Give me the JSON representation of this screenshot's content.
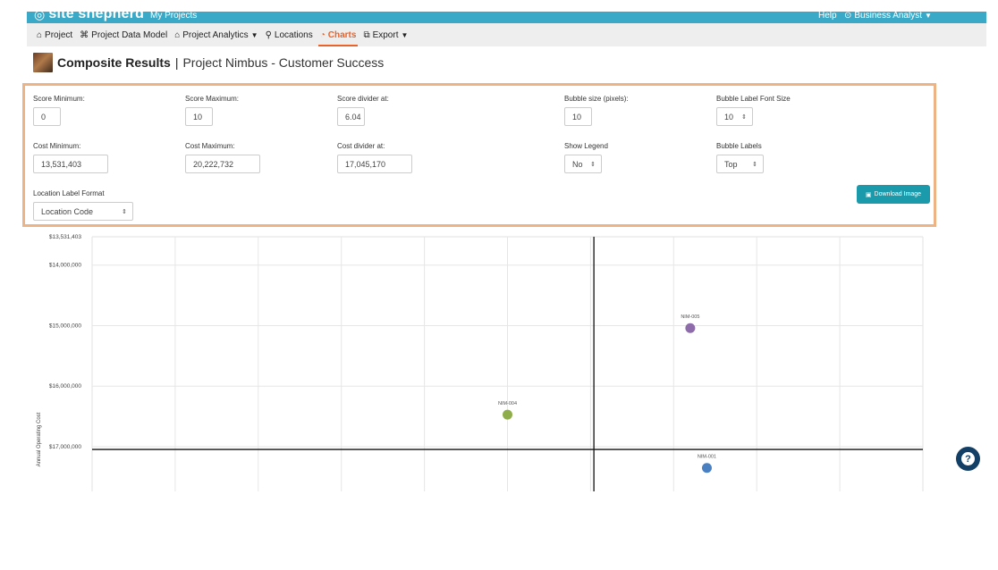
{
  "header": {
    "brand": "site shepherd",
    "my_projects": "My Projects",
    "help": "Help",
    "user": "Business Analyst",
    "color": "#3aa9c7"
  },
  "nav": {
    "items": [
      {
        "label": "Project",
        "icon": "building-icon"
      },
      {
        "label": "Project Data Model",
        "icon": "data-model-icon"
      },
      {
        "label": "Project Analytics",
        "icon": "analytics-icon",
        "dropdown": true
      },
      {
        "label": "Locations",
        "icon": "map-pin-icon"
      },
      {
        "label": "Charts",
        "icon": "chart-icon",
        "active": true
      },
      {
        "label": "Export",
        "icon": "export-icon",
        "dropdown": true
      }
    ],
    "active_color": "#e8622a"
  },
  "page": {
    "title": "Composite Results",
    "separator": "|",
    "subtitle": "Project Nimbus - Customer Success"
  },
  "controls": {
    "score_min": {
      "label": "Score Minimum:",
      "value": "0"
    },
    "score_max": {
      "label": "Score Maximum:",
      "value": "10"
    },
    "score_divider": {
      "label": "Score divider at:",
      "value": "6.04"
    },
    "bubble_size": {
      "label": "Bubble size (pixels):",
      "value": "10"
    },
    "bubble_font": {
      "label": "Bubble Label Font Size",
      "value": "10"
    },
    "cost_min": {
      "label": "Cost Minimum:",
      "value": "13,531,403"
    },
    "cost_max": {
      "label": "Cost Maximum:",
      "value": "20,222,732"
    },
    "cost_divider": {
      "label": "Cost divider at:",
      "value": "17,045,170"
    },
    "show_legend": {
      "label": "Show Legend",
      "value": "No"
    },
    "bubble_labels": {
      "label": "Bubble Labels",
      "value": "Top"
    },
    "location_format": {
      "label": "Location Label Format",
      "value": "Location Code"
    },
    "download_label": "Download Image",
    "panel_border_color": "#eeb384",
    "button_color": "#1b9aab"
  },
  "chart_data": {
    "type": "scatter",
    "ylabel": "Annual Operating Cost",
    "xlabel": "",
    "xlim": [
      0,
      10
    ],
    "ylim": [
      13531403,
      17700000
    ],
    "y_inverted": true,
    "x_divider": 6.04,
    "y_divider": 17045170,
    "y_ticks": [
      {
        "value": 13531403,
        "label": "$13,531,403"
      },
      {
        "value": 14000000,
        "label": "$14,000,000"
      },
      {
        "value": 15000000,
        "label": "$15,000,000"
      },
      {
        "value": 16000000,
        "label": "$16,000,000"
      },
      {
        "value": 17000000,
        "label": "$17,000,000"
      }
    ],
    "x_gridlines": [
      1,
      2,
      3,
      4,
      5,
      6,
      7,
      8,
      9
    ],
    "grid": true,
    "points": [
      {
        "label": "NIM-005",
        "x": 7.2,
        "y": 15040000,
        "color": "#8e6cab"
      },
      {
        "label": "NIM-004",
        "x": 5.0,
        "y": 16470000,
        "color": "#8fad4b"
      },
      {
        "label": "NIM-001",
        "x": 7.4,
        "y": 17350000,
        "color": "#4a7fc1"
      }
    ]
  },
  "help_fab": {
    "symbol": "?"
  }
}
